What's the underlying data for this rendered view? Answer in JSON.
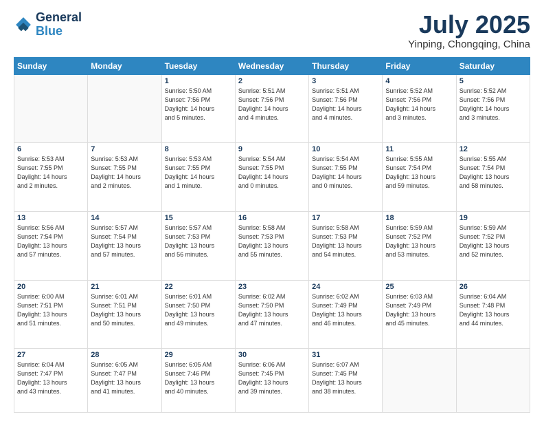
{
  "header": {
    "logo_line1": "General",
    "logo_line2": "Blue",
    "month": "July 2025",
    "location": "Yinping, Chongqing, China"
  },
  "weekdays": [
    "Sunday",
    "Monday",
    "Tuesday",
    "Wednesday",
    "Thursday",
    "Friday",
    "Saturday"
  ],
  "weeks": [
    [
      {
        "day": "",
        "info": ""
      },
      {
        "day": "",
        "info": ""
      },
      {
        "day": "1",
        "info": "Sunrise: 5:50 AM\nSunset: 7:56 PM\nDaylight: 14 hours\nand 5 minutes."
      },
      {
        "day": "2",
        "info": "Sunrise: 5:51 AM\nSunset: 7:56 PM\nDaylight: 14 hours\nand 4 minutes."
      },
      {
        "day": "3",
        "info": "Sunrise: 5:51 AM\nSunset: 7:56 PM\nDaylight: 14 hours\nand 4 minutes."
      },
      {
        "day": "4",
        "info": "Sunrise: 5:52 AM\nSunset: 7:56 PM\nDaylight: 14 hours\nand 3 minutes."
      },
      {
        "day": "5",
        "info": "Sunrise: 5:52 AM\nSunset: 7:56 PM\nDaylight: 14 hours\nand 3 minutes."
      }
    ],
    [
      {
        "day": "6",
        "info": "Sunrise: 5:53 AM\nSunset: 7:55 PM\nDaylight: 14 hours\nand 2 minutes."
      },
      {
        "day": "7",
        "info": "Sunrise: 5:53 AM\nSunset: 7:55 PM\nDaylight: 14 hours\nand 2 minutes."
      },
      {
        "day": "8",
        "info": "Sunrise: 5:53 AM\nSunset: 7:55 PM\nDaylight: 14 hours\nand 1 minute."
      },
      {
        "day": "9",
        "info": "Sunrise: 5:54 AM\nSunset: 7:55 PM\nDaylight: 14 hours\nand 0 minutes."
      },
      {
        "day": "10",
        "info": "Sunrise: 5:54 AM\nSunset: 7:55 PM\nDaylight: 14 hours\nand 0 minutes."
      },
      {
        "day": "11",
        "info": "Sunrise: 5:55 AM\nSunset: 7:54 PM\nDaylight: 13 hours\nand 59 minutes."
      },
      {
        "day": "12",
        "info": "Sunrise: 5:55 AM\nSunset: 7:54 PM\nDaylight: 13 hours\nand 58 minutes."
      }
    ],
    [
      {
        "day": "13",
        "info": "Sunrise: 5:56 AM\nSunset: 7:54 PM\nDaylight: 13 hours\nand 57 minutes."
      },
      {
        "day": "14",
        "info": "Sunrise: 5:57 AM\nSunset: 7:54 PM\nDaylight: 13 hours\nand 57 minutes."
      },
      {
        "day": "15",
        "info": "Sunrise: 5:57 AM\nSunset: 7:53 PM\nDaylight: 13 hours\nand 56 minutes."
      },
      {
        "day": "16",
        "info": "Sunrise: 5:58 AM\nSunset: 7:53 PM\nDaylight: 13 hours\nand 55 minutes."
      },
      {
        "day": "17",
        "info": "Sunrise: 5:58 AM\nSunset: 7:53 PM\nDaylight: 13 hours\nand 54 minutes."
      },
      {
        "day": "18",
        "info": "Sunrise: 5:59 AM\nSunset: 7:52 PM\nDaylight: 13 hours\nand 53 minutes."
      },
      {
        "day": "19",
        "info": "Sunrise: 5:59 AM\nSunset: 7:52 PM\nDaylight: 13 hours\nand 52 minutes."
      }
    ],
    [
      {
        "day": "20",
        "info": "Sunrise: 6:00 AM\nSunset: 7:51 PM\nDaylight: 13 hours\nand 51 minutes."
      },
      {
        "day": "21",
        "info": "Sunrise: 6:01 AM\nSunset: 7:51 PM\nDaylight: 13 hours\nand 50 minutes."
      },
      {
        "day": "22",
        "info": "Sunrise: 6:01 AM\nSunset: 7:50 PM\nDaylight: 13 hours\nand 49 minutes."
      },
      {
        "day": "23",
        "info": "Sunrise: 6:02 AM\nSunset: 7:50 PM\nDaylight: 13 hours\nand 47 minutes."
      },
      {
        "day": "24",
        "info": "Sunrise: 6:02 AM\nSunset: 7:49 PM\nDaylight: 13 hours\nand 46 minutes."
      },
      {
        "day": "25",
        "info": "Sunrise: 6:03 AM\nSunset: 7:49 PM\nDaylight: 13 hours\nand 45 minutes."
      },
      {
        "day": "26",
        "info": "Sunrise: 6:04 AM\nSunset: 7:48 PM\nDaylight: 13 hours\nand 44 minutes."
      }
    ],
    [
      {
        "day": "27",
        "info": "Sunrise: 6:04 AM\nSunset: 7:47 PM\nDaylight: 13 hours\nand 43 minutes."
      },
      {
        "day": "28",
        "info": "Sunrise: 6:05 AM\nSunset: 7:47 PM\nDaylight: 13 hours\nand 41 minutes."
      },
      {
        "day": "29",
        "info": "Sunrise: 6:05 AM\nSunset: 7:46 PM\nDaylight: 13 hours\nand 40 minutes."
      },
      {
        "day": "30",
        "info": "Sunrise: 6:06 AM\nSunset: 7:45 PM\nDaylight: 13 hours\nand 39 minutes."
      },
      {
        "day": "31",
        "info": "Sunrise: 6:07 AM\nSunset: 7:45 PM\nDaylight: 13 hours\nand 38 minutes."
      },
      {
        "day": "",
        "info": ""
      },
      {
        "day": "",
        "info": ""
      }
    ]
  ]
}
